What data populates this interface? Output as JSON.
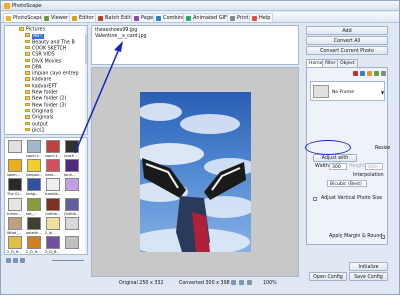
{
  "app": {
    "title": "PhotoScape"
  },
  "tabs": [
    {
      "label": "PhotoScape",
      "color": "#f0b020"
    },
    {
      "label": "Viewer",
      "color": "#6a9e3a"
    },
    {
      "label": "Editor",
      "color": "#d9a020"
    },
    {
      "label": "Batch Editor",
      "color": "#c0392b"
    },
    {
      "label": "Page",
      "color": "#8e44ad"
    },
    {
      "label": "Combine",
      "color": "#2e86c1"
    },
    {
      "label": "Animated GIF",
      "color": "#27ae60"
    },
    {
      "label": "Print",
      "color": "#7f8c8d"
    },
    {
      "label": "Help",
      "color": "#e74c3c"
    }
  ],
  "tree": {
    "items": [
      {
        "label": "Pictures",
        "selected": false
      },
      {
        "label": "ABT",
        "selected": true
      },
      {
        "label": "Beauty and The B",
        "selected": false
      },
      {
        "label": "COOK SKETCH",
        "selected": false
      },
      {
        "label": "CSR VIDS",
        "selected": false
      },
      {
        "label": "DivX Movies",
        "selected": false
      },
      {
        "label": "DPA",
        "selected": false
      },
      {
        "label": "impian cayo entrep",
        "selected": false
      },
      {
        "label": "kadvare",
        "selected": false
      },
      {
        "label": "kadvarEFT",
        "selected": false
      },
      {
        "label": "New folder",
        "selected": false
      },
      {
        "label": "New folder (2)",
        "selected": false
      },
      {
        "label": "New folder (3)",
        "selected": false
      },
      {
        "label": "Originals",
        "selected": false
      },
      {
        "label": "Originals",
        "selected": false
      },
      {
        "label": "output",
        "selected": false
      },
      {
        "label": "pics1",
        "selected": false
      }
    ]
  },
  "thumbs": [
    {
      "caption": "",
      "color": "#e0e0e0"
    },
    {
      "caption": "copin t...",
      "color": "#a0b8d0"
    },
    {
      "caption": "copin t...",
      "color": "#c04040"
    },
    {
      "caption": "roach ...",
      "color": "#303030"
    },
    {
      "caption": "salen...",
      "color": "#e8b020"
    },
    {
      "caption": "simpso...",
      "color": "#f0d030"
    },
    {
      "caption": "hese...",
      "color": "#d05060"
    },
    {
      "caption": "lanit...",
      "color": "#502a80"
    },
    {
      "caption": "The Gi...",
      "color": "#2a2a2a"
    },
    {
      "caption": "imag...",
      "color": "#3050a0"
    },
    {
      "caption": "tumble...",
      "color": "#f0f0f0"
    },
    {
      "caption": "",
      "color": "#c0a0e0"
    },
    {
      "caption": "tumbl...",
      "color": "#e6e6e6"
    },
    {
      "caption": "sat_...",
      "color": "#8a9a40"
    },
    {
      "caption": "Untitle...",
      "color": "#803020"
    },
    {
      "caption": "Untitle...",
      "color": "#6060a0"
    },
    {
      "caption": "What_...",
      "color": "#c0a080"
    },
    {
      "caption": "whatth...",
      "color": "#404030"
    },
    {
      "caption": "2_bl...",
      "color": "#f0e0a0"
    },
    {
      "caption": "",
      "color": "#d8d8d8"
    },
    {
      "caption": "2_D_H...",
      "color": "#e0c040"
    },
    {
      "caption": "2_D_H...",
      "color": "#d08020"
    },
    {
      "caption": "2_D_H...",
      "color": "#7050a0"
    },
    {
      "caption": "",
      "color": "#c0c0c0"
    }
  ],
  "files": [
    "theseshoes99.jpg",
    "Valentine__s_card.jpg"
  ],
  "status": {
    "original": "Original 250 x 332",
    "converted": "Converted 300 x 398",
    "zoom": "100%"
  },
  "right": {
    "add": "Add",
    "convert_all": "Convert All",
    "convert_current": "Convert Current Photo",
    "tabs": [
      "Home",
      "filter",
      "Object"
    ],
    "frame": "No Frame",
    "resize_title": "Resize",
    "adjust_with": "Adjust with",
    "width_label": "Width",
    "width_value": "300",
    "height_label": "Height",
    "height_value": "400",
    "interp_label": "Interpolation",
    "interp_value": "Bicubic (Best)",
    "adjust_vertical": "Adjust Vertical Photo Size",
    "apply_margin": "Apply Margin & Round",
    "initialize": "Initialize",
    "open_config": "Open Config",
    "save_config": "Save Config"
  },
  "annotation": {
    "color": "#1a22c0"
  }
}
